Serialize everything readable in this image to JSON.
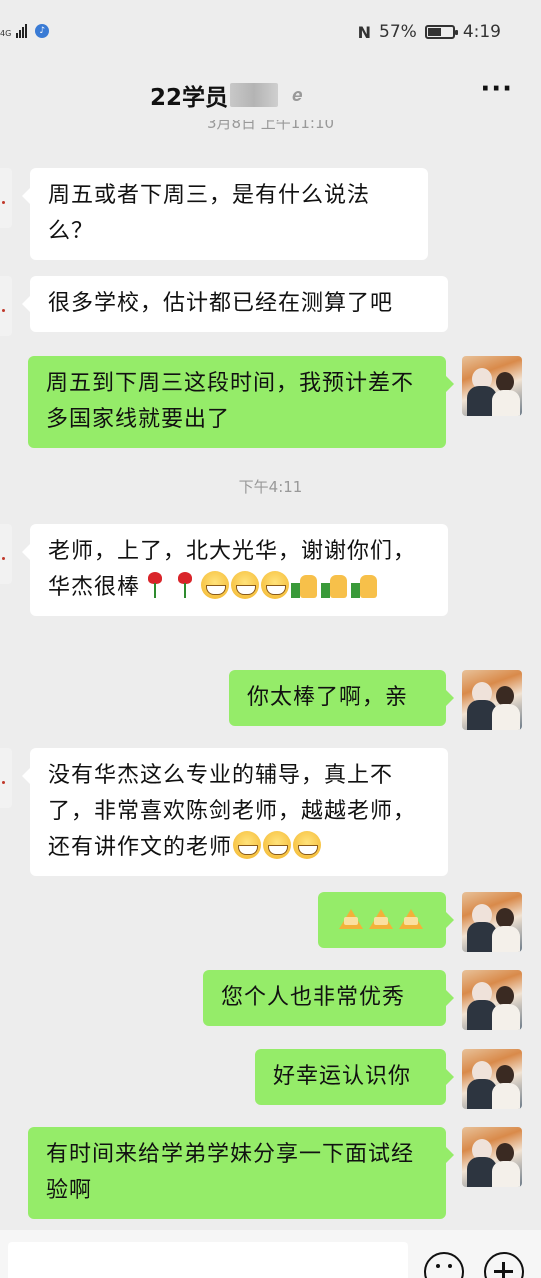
{
  "status_bar": {
    "network": "4G",
    "battery_percent_text": "57%",
    "battery_level": 0.57,
    "time": "4:19",
    "icons": [
      "signal-icon",
      "music-icon",
      "nfc-icon",
      "battery-icon"
    ]
  },
  "header": {
    "title": "22学员",
    "title_redacted": true,
    "ear_icon": "ear-icon",
    "more_label": "···"
  },
  "timestamps": {
    "top_partial": "3月8日 上午11:10",
    "afternoon": "下午4:11"
  },
  "messages": [
    {
      "side": "in",
      "text": "周五或者下周三，是有什么说法么？"
    },
    {
      "side": "in",
      "text": "很多学校，估计都已经在测算了吧"
    },
    {
      "side": "out",
      "text": "周五到下周三这段时间，我预计差不多国家线就要出了"
    },
    {
      "side": "in",
      "text": "老师，上了，北大光华，谢谢你们，华杰很棒",
      "emoji": [
        "rose",
        "rose",
        "grin",
        "grin",
        "grin",
        "thumbs-up",
        "thumbs-up",
        "thumbs-up"
      ]
    },
    {
      "side": "out",
      "text": "你太棒了啊，亲"
    },
    {
      "side": "in",
      "text": "没有华杰这么专业的辅导，真上不了，非常喜欢陈剑老师，越越老师，还有讲作文的老师",
      "emoji": [
        "grin",
        "grin",
        "grin"
      ]
    },
    {
      "side": "out",
      "text": "",
      "emoji": [
        "clap",
        "clap",
        "clap"
      ]
    },
    {
      "side": "out",
      "text": "您个人也非常优秀"
    },
    {
      "side": "out",
      "text": "好幸运认识你"
    },
    {
      "side": "out",
      "text": "有时间来给学弟学妹分享一下面试经验啊"
    }
  ],
  "colors": {
    "background": "#ededed",
    "outgoing_bubble": "#95ec69",
    "incoming_bubble": "#ffffff",
    "timestamp": "#999999"
  },
  "input_bar": {
    "emoji_button_icon": "emoji-icon",
    "plus_button_icon": "plus-icon"
  }
}
